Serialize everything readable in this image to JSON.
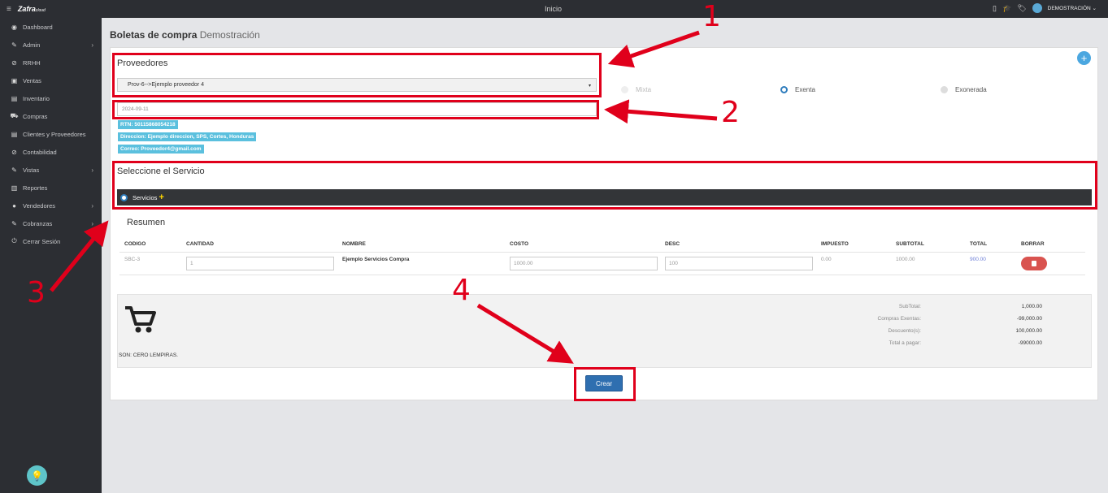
{
  "sidebar": {
    "menu_icon": "≡",
    "logo": "Zafra",
    "logo_suffix": "cloud",
    "items": [
      {
        "label": "Dashboard",
        "icon": "dashboard-icon",
        "glyph": "◉"
      },
      {
        "label": "Admin",
        "icon": "wrench-icon",
        "glyph": "✎",
        "has_submenu": true
      },
      {
        "label": "RRHH",
        "icon": "paperclip-icon",
        "glyph": "⊘"
      },
      {
        "label": "Ventas",
        "icon": "video-icon",
        "glyph": "▣"
      },
      {
        "label": "Inventario",
        "icon": "book-icon",
        "glyph": "▤"
      },
      {
        "label": "Compras",
        "icon": "cart-icon",
        "glyph": "⛟"
      },
      {
        "label": "Clientes y Proveedores",
        "icon": "book-icon",
        "glyph": "▤"
      },
      {
        "label": "Contabilidad",
        "icon": "paperclip-icon",
        "glyph": "⊘"
      },
      {
        "label": "Vistas",
        "icon": "edit-icon",
        "glyph": "✎",
        "has_submenu": true
      },
      {
        "label": "Reportes",
        "icon": "list-icon",
        "glyph": "▥"
      },
      {
        "label": "Vendedores",
        "icon": "user-icon",
        "glyph": "●",
        "has_submenu": true
      },
      {
        "label": "Cobranzas",
        "icon": "edit-icon",
        "glyph": "✎",
        "has_submenu": true
      },
      {
        "label": "Cerrar Sesión",
        "icon": "power-icon",
        "glyph": "⏻"
      }
    ],
    "chevron": "›",
    "bulb_icon": "lightbulb-icon",
    "bulb_glyph": "💡"
  },
  "topbar": {
    "title": "Inicio",
    "icons": {
      "mobile": "▯",
      "graduation": "🎓",
      "tags": "🏷"
    },
    "user": "DEMOSTRACIÓN ⌄"
  },
  "page": {
    "title_bold": "Boletas de compra",
    "title_sub": "Demostración"
  },
  "proveedores": {
    "title": "Proveedores",
    "selected": "Prov-6-->Ejemplo proveedor 4",
    "caret": "▾",
    "options": [
      {
        "label": "Mixta",
        "state": "disabled"
      },
      {
        "label": "Exenta",
        "state": "selected"
      },
      {
        "label": "Exonerada",
        "state": "unselected"
      }
    ],
    "date": "2024-09-11",
    "rtn": "RTN: 50115868054218",
    "direccion": "Direccion: Ejemplo direccion, SPS, Cortes, Honduras",
    "correo": "Correo: Proveedor4@gmail.com",
    "add_icon": "+"
  },
  "servicio": {
    "title": "Seleccione el Servicio",
    "option": "Servicios",
    "plus": "+"
  },
  "resumen": {
    "title": "Resumen",
    "headers": [
      "CODIGO",
      "CANTIDAD",
      "NOMBRE",
      "COSTO",
      "DESC",
      "IMPUESTO",
      "SUBTOTAL",
      "TOTAL",
      "BORRAR"
    ],
    "row": {
      "codigo": "SBC-3",
      "cantidad": "1",
      "nombre": "Ejemplo Servicios Compra",
      "costo": "1000.00",
      "desc": "100",
      "impuesto": "0.00",
      "subtotal": "1000.00",
      "total": "900.00",
      "delete_icon": "trash-icon",
      "delete_glyph": "🗑"
    }
  },
  "totales": {
    "cart_icon": "shopping-cart-icon",
    "cart_glyph": "🛒",
    "son": "SON: CERO LEMPIRAS.",
    "labels": [
      "SubTotal:",
      "Compras Exentas:",
      "Descuento(s):",
      "Total a pagar:"
    ],
    "values": [
      "1,000.00",
      "-99,000.00",
      "100,000.00",
      "-99000.00"
    ]
  },
  "actions": {
    "crear": "Crear"
  },
  "annotations": {
    "numbers": [
      "1",
      "2",
      "3",
      "4"
    ],
    "color": "#e0001b"
  },
  "colors": {
    "sidebar": "#2c2e33",
    "badge": "#5bc0de",
    "primary": "#2f6fb0",
    "danger": "#d9534f"
  }
}
